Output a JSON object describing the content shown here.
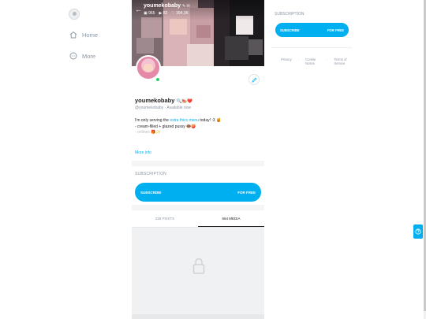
{
  "nav": {
    "home_label": "Home",
    "more_label": "More"
  },
  "cover": {
    "name": "youmekobaby",
    "name_badges": "✎ ✉",
    "stats": {
      "photos": "965",
      "videos": "82",
      "likes": "394.3K"
    }
  },
  "profile": {
    "display_name": "youmekobaby",
    "name_emojis": "🔍🍉❤️",
    "handle": "@youmekobaby",
    "status": "Available now",
    "bio_line1_prefix": "I'm only serving the ",
    "bio_line1_link": "extra thicc menu",
    "bio_line1_suffix": " today! :3 🍯",
    "bio_line2": "- cream-filled + glazed pussy 🍩🍑",
    "bio_line3": "- onlines 🎁✨",
    "more_info": "More info"
  },
  "subscription": {
    "title": "SUBSCRIPTION",
    "button_left": "SUBSCRIBE",
    "button_right": "FOR FREE"
  },
  "tabs": {
    "posts": "226 POSTS",
    "media": "664 MEDIA"
  },
  "right_panel": {
    "title": "SUBSCRIPTION",
    "button_left": "SUBSCRIBE",
    "button_right": "FOR FREE"
  },
  "footer": {
    "privacy": "Privacy",
    "cookie": "Cookie Notice",
    "terms": "Terms of Service"
  },
  "colors": {
    "accent": "#00aff0",
    "muted": "#8a96a3"
  }
}
